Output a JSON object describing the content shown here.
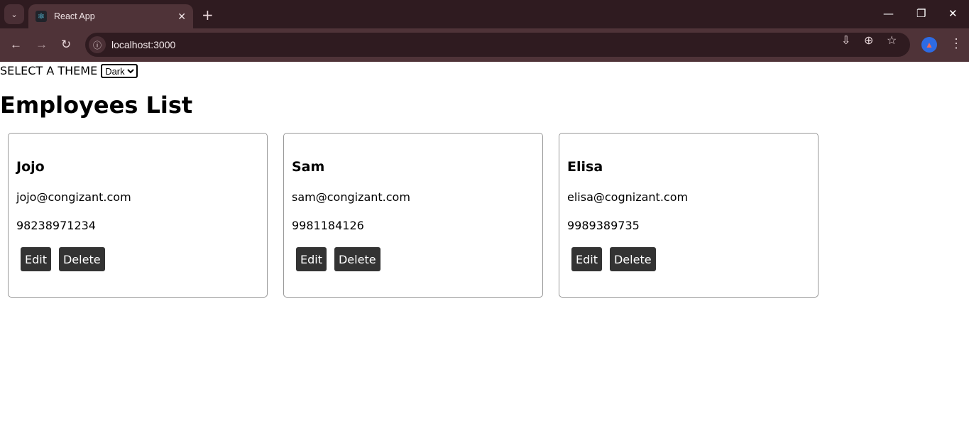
{
  "browser": {
    "tab_title": "React App",
    "url": "localhost:3000"
  },
  "theme": {
    "label": "SELECT A THEME",
    "selected": "Dark"
  },
  "page": {
    "title": "Employees List"
  },
  "buttons": {
    "edit": "Edit",
    "delete": "Delete"
  },
  "employees": [
    {
      "name": "Jojo",
      "email": "jojo@congizant.com",
      "phone": "98238971234"
    },
    {
      "name": "Sam",
      "email": "sam@congizant.com",
      "phone": "9981184126"
    },
    {
      "name": "Elisa",
      "email": "elisa@cognizant.com",
      "phone": "9989389735"
    }
  ]
}
